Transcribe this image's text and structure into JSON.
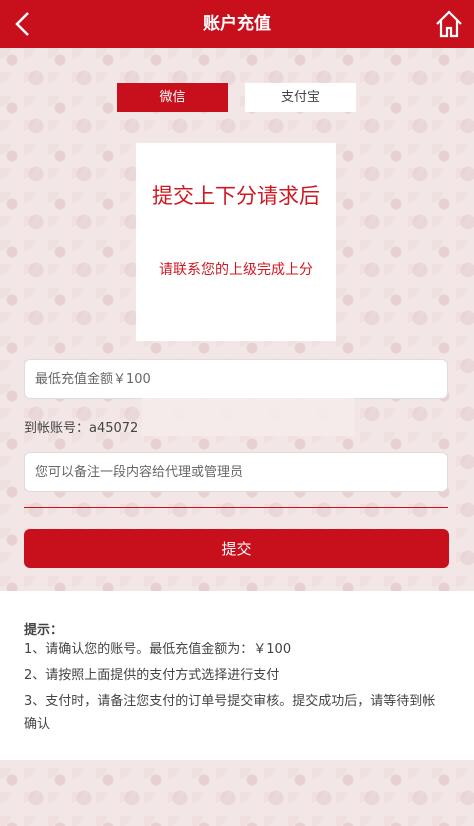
{
  "header": {
    "title": "账户充值"
  },
  "tabs": [
    {
      "label": "微信",
      "active": true
    },
    {
      "label": "支付宝",
      "active": false
    }
  ],
  "notice": {
    "main_text": "提交上下分请求后",
    "sub_text": "请联系您的上级完成上分"
  },
  "form": {
    "amount_placeholder": "最低充值金额￥100",
    "account_label": "到帐账号：a45072",
    "note_placeholder": "您可以备注一段内容给代理或管理员",
    "submit_label": "提交"
  },
  "tips": {
    "title": "提示：",
    "items": [
      "1、请确认您的账号。最低充值金额为：￥100",
      "2、请按照上面提供的支付方式选择进行支付",
      "3、支付时，请备注您支付的订单号提交审核。提交成功后，请等待到帐确认"
    ]
  },
  "colors": {
    "brand_red": "#c8101d",
    "notice_red": "#d01822"
  },
  "icons": {
    "back": "chevron-left-icon",
    "home": "home-icon"
  }
}
